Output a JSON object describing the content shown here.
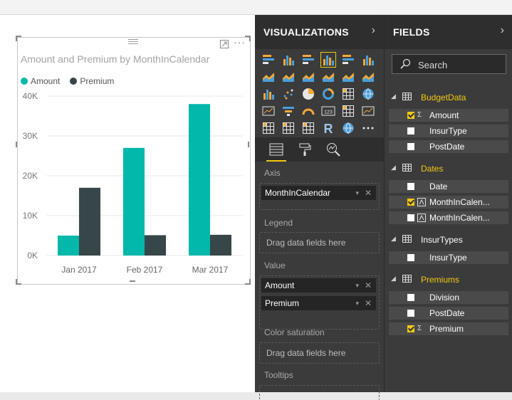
{
  "visual": {
    "title": "Amount and Premium by MonthInCalendar",
    "menu": "···"
  },
  "chart_data": {
    "type": "bar",
    "title": "Amount and Premium by MonthInCalendar",
    "categories": [
      "Jan 2017",
      "Feb 2017",
      "Mar 2017"
    ],
    "series": [
      {
        "name": "Amount",
        "values": [
          5000,
          27000,
          38000
        ],
        "color": "#01b8aa"
      },
      {
        "name": "Premium",
        "values": [
          17000,
          5100,
          5200
        ],
        "color": "#374649"
      }
    ],
    "yticks": [
      "0K",
      "10K",
      "20K",
      "30K",
      "40K"
    ],
    "ylim": [
      0,
      40000
    ],
    "legend": "top-left",
    "grid": true
  },
  "visualizations": {
    "title": "VISUALIZATIONS",
    "chevron": "›",
    "more": "···",
    "icon_names": [
      "stacked-bar-icon",
      "stacked-column-icon",
      "clustered-bar-icon",
      "clustered-column-icon",
      "100-stacked-bar-icon",
      "100-stacked-column-icon",
      "line-chart-icon",
      "area-chart-icon",
      "stacked-area-icon",
      "line-clustered-column-icon",
      "line-stacked-column-icon",
      "ribbon-chart-icon",
      "waterfall-icon",
      "scatter-icon",
      "pie-chart-icon",
      "donut-chart-icon",
      "treemap-icon",
      "map-icon",
      "filled-map-icon",
      "funnel-icon",
      "gauge-icon",
      "card-icon",
      "multi-row-card-icon",
      "kpi-icon",
      "slicer-icon",
      "table-icon",
      "matrix-icon",
      "r-visual-icon",
      "globe-icon",
      "more-icon"
    ],
    "card_text": "123",
    "r_text": "R",
    "sections": {
      "axis": {
        "label": "Axis",
        "fields": [
          "MonthInCalendar"
        ]
      },
      "legend": {
        "label": "Legend",
        "hint": "Drag data fields here"
      },
      "value": {
        "label": "Value",
        "fields": [
          "Amount",
          "Premium"
        ]
      },
      "color_saturation": {
        "label": "Color saturation",
        "hint": "Drag data fields here"
      },
      "tooltips": {
        "label": "Tooltips"
      }
    },
    "pill_dropdown": "▾",
    "pill_remove": "✕"
  },
  "fields": {
    "title": "FIELDS",
    "chevron": "›",
    "search_placeholder": "Search",
    "sigma": "Σ",
    "collapse": "◢",
    "tables": [
      {
        "name": "BudgetData",
        "highlight": true,
        "fields": [
          {
            "name": "Amount",
            "checked": true,
            "icon": "Σ"
          },
          {
            "name": "InsurType",
            "checked": false,
            "icon": ""
          },
          {
            "name": "PostDate",
            "checked": false,
            "icon": ""
          }
        ]
      },
      {
        "name": "Dates",
        "highlight": true,
        "fields": [
          {
            "name": "Date",
            "checked": false,
            "icon": ""
          },
          {
            "name": "MonthInCalen...",
            "checked": true,
            "icon": "calc-column-icon"
          },
          {
            "name": "MonthInCalen...",
            "checked": false,
            "icon": "calc-column-icon"
          }
        ]
      },
      {
        "name": "InsurTypes",
        "highlight": false,
        "fields": [
          {
            "name": "InsurType",
            "checked": false,
            "icon": ""
          }
        ]
      },
      {
        "name": "Premiums",
        "highlight": true,
        "fields": [
          {
            "name": "Division",
            "checked": false,
            "icon": ""
          },
          {
            "name": "PostDate",
            "checked": false,
            "icon": ""
          },
          {
            "name": "Premium",
            "checked": true,
            "icon": "Σ"
          }
        ]
      }
    ]
  }
}
